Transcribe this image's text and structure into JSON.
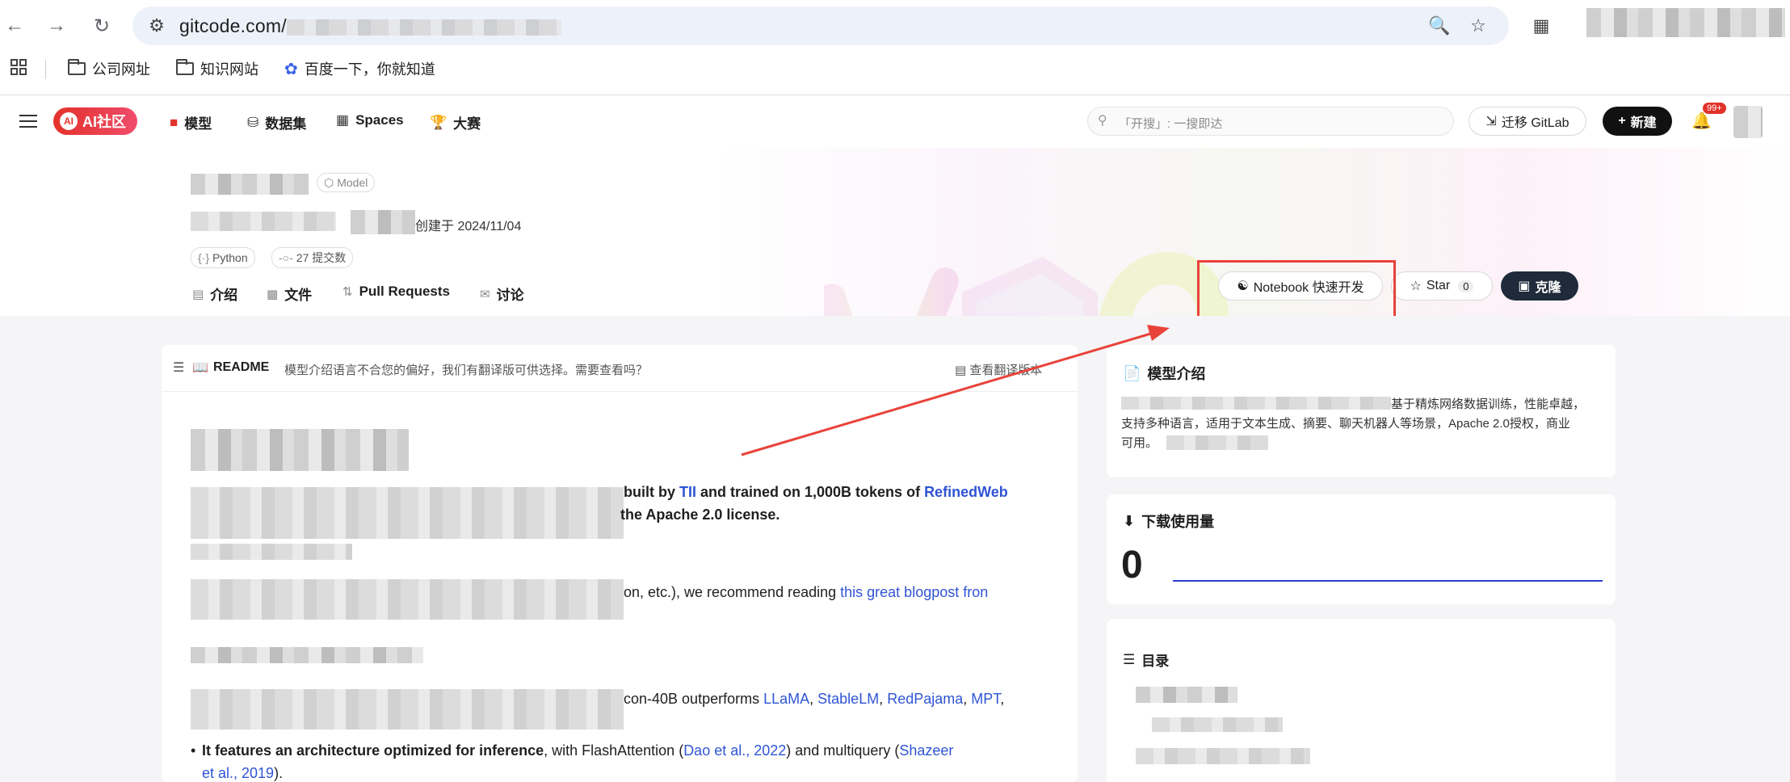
{
  "browser": {
    "url_prefix": "gitcode.com/",
    "bookmarks": [
      {
        "label": "公司网址"
      },
      {
        "label": "知识网站"
      },
      {
        "label": "百度一下，你就知道"
      }
    ]
  },
  "header": {
    "logo_text": "AI社区",
    "logo_badge": "AI",
    "nav": [
      "模型",
      "数据集",
      "Spaces",
      "大赛"
    ],
    "search_placeholder": "「开搜」: 一搜即达",
    "migrate_label": "迁移 GitLab",
    "new_label": "新建",
    "notification_count": "99+"
  },
  "repo": {
    "model_tag": "Model",
    "created": "创建于 2024/11/04",
    "lang_tag": "Python",
    "commits_tag": "27 提交数",
    "tabs": [
      "介绍",
      "文件",
      "Pull Requests",
      "讨论"
    ],
    "notebook_btn": "Notebook 快速开发",
    "star_label": "Star",
    "star_count": "0",
    "clone_label": "克隆"
  },
  "readme": {
    "title": "README",
    "notice": "模型介绍语言不合您的偏好，我们有翻译版可供选择。需要查看吗？",
    "view_translation": "查看翻译版本",
    "line1_a": "built by ",
    "line1_tii": "TII",
    "line1_b": " and trained on 1,000B tokens of ",
    "line1_refinedweb": "RefinedWeb",
    "line2": "the Apache 2.0 license.",
    "line3_a": "on, etc.), we recommend reading ",
    "line3_link": "this great blogpost fron",
    "line4_a": "con-40B outperforms ",
    "line4_links": [
      "LLaMA",
      "StableLM",
      "RedPajama",
      "MPT"
    ],
    "bullet_bold": "It features an architecture optimized for inference",
    "bullet_a": ", with FlashAttention (",
    "bullet_link1": "Dao et al., 2022",
    "bullet_b": ") and multiquery (",
    "bullet_link2": "Shazeer",
    "bullet_link2b": "et al., 2019",
    "bullet_c": ")."
  },
  "sidebar": {
    "intro_title": "模型介绍",
    "intro_text_1": "基于精炼网络数据训练，性能卓越，",
    "intro_text_2": "支持多种语言，适用于文本生成、摘要、聊天机器人等场景，Apache 2.0授权，商业",
    "intro_text_3": "可用。",
    "downloads_title": "下载使用量",
    "downloads_count": "0",
    "toc_title": "目录"
  },
  "colors": {
    "accent_red": "#e8433a",
    "link_blue": "#2f55d4"
  }
}
